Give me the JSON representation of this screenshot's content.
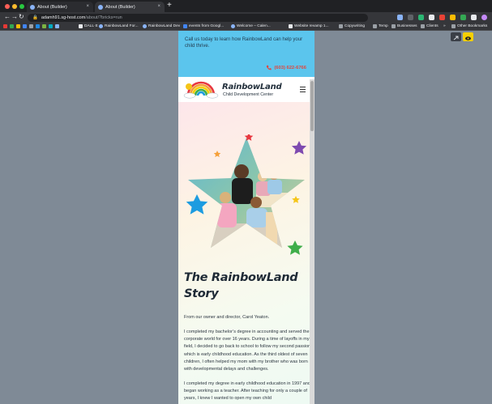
{
  "browser": {
    "tabs": [
      {
        "title": "About (Builder)",
        "active": false
      },
      {
        "title": "About (Builder)",
        "active": true
      }
    ],
    "new_tab": "+",
    "close": "×",
    "url_host": "adamh91.sg-host.com",
    "url_path": "/about/?bricks=run",
    "nav": {
      "back": "←",
      "forward": "→",
      "reload": "↻"
    },
    "bookmarks": [
      "DALL·E",
      "RainbowLand For...",
      "RainbowLand Dev",
      "events from Googl...",
      "Welcome – Calen...",
      "Website revamp 1...",
      "Copywriting",
      "Temp",
      "Businesses",
      "Clients",
      "»",
      "Other Bookmarks"
    ]
  },
  "site": {
    "topbar": {
      "call_text": "Call us today to learn how RainbowLand can help your child thrive.",
      "phone": "(603) 622-6766"
    },
    "header": {
      "brand": "RainbowLand",
      "tagline": "Child Development Center"
    },
    "hero": {
      "title_line1": "The RainbowLand",
      "title_line2": "Story"
    },
    "body": {
      "p1": "From our owner and director, Carol Yeaton.",
      "p2": "I completed my bachelor’s degree in accounting and served the corporate world for over 16 years. During a time of layoffs in my field, I decided to go back to school to follow my second passion, which is early childhood education. As the third oldest of seven children, I often helped my mom with my brother who was born with developmental delays and challenges.",
      "p3": "I completed my degree in early childhood education in 1997 and began working as a teacher. After teaching for only a couple of years, I knew I wanted to open my own child"
    }
  },
  "colors": {
    "topbar": "#5bc5ed",
    "phone": "#e2473e",
    "canvas": "#7f8a96",
    "star_red": "#e8373f",
    "star_orange": "#f5a03a",
    "star_purple": "#7e4ab0",
    "star_blue": "#1d9ce0",
    "star_yellow": "#f5c518",
    "star_green": "#3fae4a"
  },
  "icons": [
    "phone-icon",
    "menu-icon",
    "lock-icon",
    "star-icon",
    "share-icon",
    "eye-icon"
  ]
}
